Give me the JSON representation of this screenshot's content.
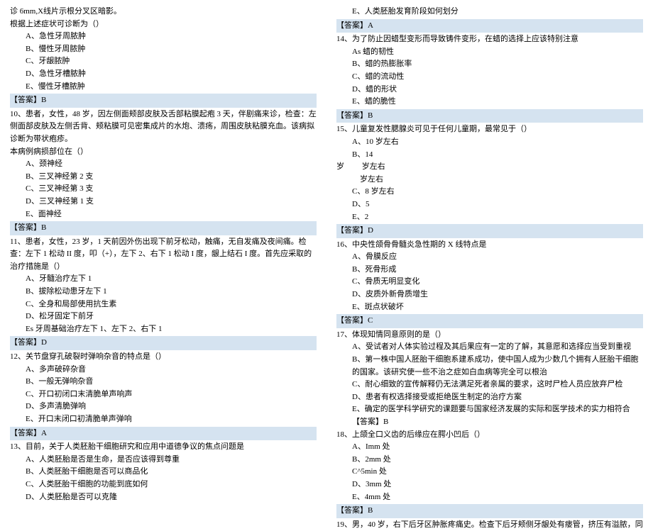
{
  "left": [
    {
      "t": "诊 6mm,X线片示根分叉区暗影。",
      "cls": ""
    },
    {
      "t": "根据上述症状可诊断为（）",
      "cls": ""
    },
    {
      "t": "A、急性牙周脓肿",
      "cls": "indent1"
    },
    {
      "t": "B、慢性牙周脓肿",
      "cls": "indent1"
    },
    {
      "t": "C、牙龈脓肿",
      "cls": "indent1"
    },
    {
      "t": "D、急性牙槽脓肿",
      "cls": "indent1"
    },
    {
      "t": "E、慢性牙槽脓肿",
      "cls": "indent1"
    },
    {
      "t": "【答案】B",
      "cls": "answer"
    },
    {
      "t": "10、患者，女性，48 岁，因左侧面颊部皮肤及舌部粘膜起疱 3 天，伴剧痛来诊，检查：左侧面部皮肤及左侧舌背、颊粘膜可见密集成片的水炮、溃疡，周围皮肤粘膜充血。该病拟诊断为带状疱疹。",
      "cls": ""
    },
    {
      "t": "本病例病损部位在（）",
      "cls": ""
    },
    {
      "t": "A、颈神经",
      "cls": "indent1"
    },
    {
      "t": "B、三叉神经第 2 支",
      "cls": "indent1"
    },
    {
      "t": "C、三叉神经第 3 支",
      "cls": "indent1"
    },
    {
      "t": "D、三叉神经第 1 支",
      "cls": "indent1"
    },
    {
      "t": "E、面神经",
      "cls": "indent1"
    },
    {
      "t": "【答案】B",
      "cls": "answer"
    },
    {
      "t": "11、患者，女性，23 岁，1 天前因外伤出现下前牙松动，触痛，无自发痛及夜间痛。检查：左下 1 松动 II 度，叩（+），左下 2、右下 1 松动 I 度，龈上结石 I 度。首先应采取的治疗措施是（）",
      "cls": ""
    },
    {
      "t": "A、牙髓治疗左下 1",
      "cls": "indent1"
    },
    {
      "t": "B、拔除松动患牙左下 1",
      "cls": "indent1"
    },
    {
      "t": "C、全身和局部使用抗生素",
      "cls": "indent1"
    },
    {
      "t": "D、松牙固定下前牙",
      "cls": "indent1"
    },
    {
      "t": "Es 牙周基础治疗左下 1、左下 2、右下 1",
      "cls": "indent1"
    },
    {
      "t": "【答案】D",
      "cls": "answer"
    },
    {
      "t": "12、关节盘穿孔破裂时弹响杂音的特点是（）",
      "cls": ""
    },
    {
      "t": "A、多声破碎杂音",
      "cls": "indent1"
    },
    {
      "t": "B、一般无弹响杂音",
      "cls": "indent1"
    },
    {
      "t": "C、开口初闭口末清脆单声响声",
      "cls": "indent1"
    },
    {
      "t": "D、多声清脆弹响",
      "cls": "indent1"
    },
    {
      "t": "E、开口末闭口初清脆单声弹响",
      "cls": "indent1"
    },
    {
      "t": "【答案】A",
      "cls": "answer"
    },
    {
      "t": "13、目前，关于人类胚胎干细胞研究和应用中道德争议的焦点问题是",
      "cls": ""
    },
    {
      "t": "A、人类胚胎是否是生命，是否应该得到尊重",
      "cls": "indent1"
    },
    {
      "t": "B、人类胚胎干细胞是否可以商品化",
      "cls": "indent1"
    },
    {
      "t": "C、人类胚胎干细胞的功能到底如何",
      "cls": "indent1"
    },
    {
      "t": "D、人类胚胎是否可以克隆",
      "cls": "indent1"
    }
  ],
  "right": [
    {
      "t": "E、人类胚胎发育阶段如何划分",
      "cls": "indent1"
    },
    {
      "t": "【答案】A",
      "cls": "answer"
    },
    {
      "t": "14、为了防止因蜡型变形而导致铸件变形，在蜡的选择上应该特别注意",
      "cls": ""
    },
    {
      "t": "As 蜡的韧性",
      "cls": "indent1"
    },
    {
      "t": "B、蜡的热膨胀率",
      "cls": "indent1"
    },
    {
      "t": "C、蜡的流动性",
      "cls": "indent1"
    },
    {
      "t": "D、蜡的形状",
      "cls": "indent1"
    },
    {
      "t": "E、蜡的脆性",
      "cls": "indent1"
    },
    {
      "t": "【答案】B",
      "cls": "answer"
    },
    {
      "t": "15、儿童复发性腮腺炎可见于任何儿童期，最常见于（）",
      "cls": ""
    },
    {
      "t": "A、10 岁左右",
      "cls": "indent1"
    },
    {
      "t": "B、14",
      "cls": "indent1"
    },
    {
      "t": "岁         岁左右",
      "cls": ""
    },
    {
      "t": "            岁左右",
      "cls": ""
    },
    {
      "t": "C、8 岁左右",
      "cls": "indent1"
    },
    {
      "t": "D、5",
      "cls": "indent1"
    },
    {
      "t": "E、2",
      "cls": "indent1"
    },
    {
      "t": "【答案】D",
      "cls": "answer"
    },
    {
      "t": "16、中央性颌骨骨髓炎急性期的 X 线特点是",
      "cls": ""
    },
    {
      "t": "A、骨膜反应",
      "cls": "indent1"
    },
    {
      "t": "B、死骨形成",
      "cls": "indent1"
    },
    {
      "t": "C、骨质无明显变化",
      "cls": "indent1"
    },
    {
      "t": "D、皮质外新骨质增生",
      "cls": "indent1"
    },
    {
      "t": "E、斑点状破坏",
      "cls": "indent1"
    },
    {
      "t": "【答案】C",
      "cls": "answer"
    },
    {
      "t": "17、体现知情同意原则的是（）",
      "cls": ""
    },
    {
      "t": "A、受试者对人体实验过程及其后果应有一定的了解，其意愿和选择应当受到重视",
      "cls": "indent1"
    },
    {
      "t": "B、第一株中国人胚胎干细胞系建系成功，使中国人成为少数几个拥有人胚胎干细胞的国家。该研究使一些不治之症如白血病等完全可以根治",
      "cls": "indent1"
    },
    {
      "t": "C、耐心细致的宣传解释仍无法满足死者亲属的要求，这时尸检人员应放弃尸检",
      "cls": "indent1"
    },
    {
      "t": "D、患者有权选择接受或拒绝医生制定的治疗方案",
      "cls": "indent1"
    },
    {
      "t": "E、确定的医学科学研究的课题要与国家经济发展的实际和医学技术的实力相符合【答案】B",
      "cls": "indent1"
    },
    {
      "t": "18、上颌全口义齿的后缘应在腭小凹后（）",
      "cls": ""
    },
    {
      "t": "A、Imm 处",
      "cls": "indent1"
    },
    {
      "t": "B、2mm 处",
      "cls": "indent1"
    },
    {
      "t": "C^5min 处",
      "cls": "indent1"
    },
    {
      "t": "D、3mm 处",
      "cls": "indent1"
    },
    {
      "t": "E、4mm 处",
      "cls": "indent1"
    },
    {
      "t": "【答案】B",
      "cls": "answer"
    },
    {
      "t": "19、男，40 岁，右下后牙区肿胀疼痛史。检查下后牙颊侧牙龈处有瘘管，挤压有溢脓，同",
      "cls": ""
    }
  ]
}
